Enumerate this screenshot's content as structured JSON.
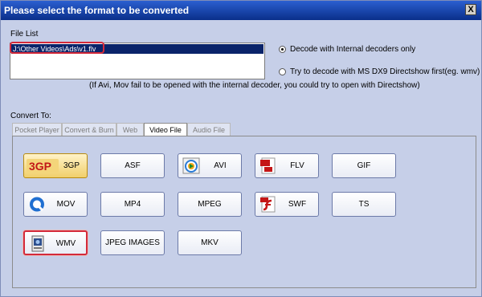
{
  "dialog": {
    "title": "Please select the format to be converted",
    "close_label": "X"
  },
  "file_list": {
    "label": "File List",
    "items": [
      "J:\\Other Videos\\Ads\\v1.flv"
    ]
  },
  "decode": {
    "option1": "Decode with Internal decoders only",
    "option2": "Try to decode with MS DX9 Directshow first(eg. wmv)",
    "selected": "option1",
    "note": "(If Avi, Mov fail to be opened with the internal decoder, you could try to open with Directshow)"
  },
  "convert": {
    "label": "Convert To:",
    "tabs": [
      "Pocket Player",
      "Convert & Burn",
      "Web",
      "Video File",
      "Audio File"
    ],
    "active_tab": "Video File"
  },
  "formats": {
    "items": [
      {
        "label": "3GP",
        "icon": "3gp-logo-icon",
        "icon_text": "3GP"
      },
      {
        "label": "ASF"
      },
      {
        "label": "AVI",
        "icon": "avi-media-icon"
      },
      {
        "label": "FLV",
        "icon": "flv-file-icon"
      },
      {
        "label": "GIF"
      },
      {
        "label": "MOV",
        "icon": "quicktime-icon"
      },
      {
        "label": "MP4"
      },
      {
        "label": "MPEG"
      },
      {
        "label": "SWF",
        "icon": "flash-icon"
      },
      {
        "label": "TS"
      },
      {
        "label": "WMV",
        "icon": "wmv-file-icon"
      },
      {
        "label": "JPEG IMAGES"
      },
      {
        "label": "MKV"
      }
    ],
    "highlighted": "WMV"
  },
  "colors": {
    "titlebar": "#0f3ea3",
    "dialog_bg": "#c6cfe8",
    "highlight": "#d42a3a"
  }
}
